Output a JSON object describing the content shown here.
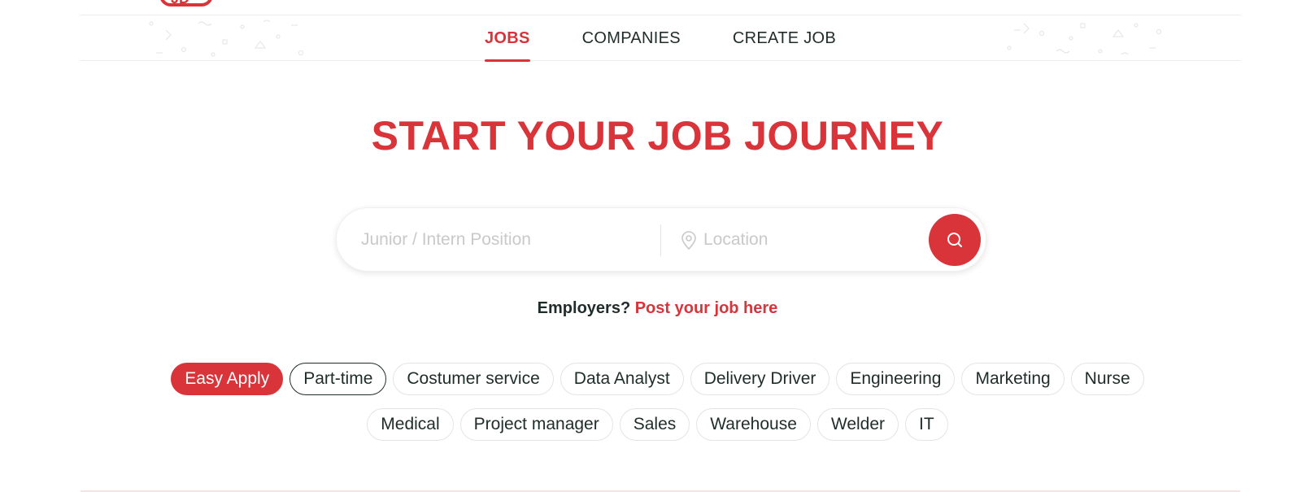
{
  "logo": {
    "text": "JD"
  },
  "nav": {
    "tabs": [
      {
        "label": "JOBS",
        "active": true
      },
      {
        "label": "COMPANIES",
        "active": false
      },
      {
        "label": "CREATE JOB",
        "active": false
      }
    ]
  },
  "hero": {
    "title": "START YOUR JOB JOURNEY"
  },
  "search": {
    "position_placeholder": "Junior / Intern Position",
    "location_placeholder": "Location",
    "position_value": "",
    "location_value": ""
  },
  "employers": {
    "question": "Employers?",
    "link": "Post your job here"
  },
  "tags": {
    "row1": [
      {
        "label": "Easy Apply",
        "style": "filled"
      },
      {
        "label": "Part-time",
        "style": "outlined"
      },
      {
        "label": "Costumer service",
        "style": "plain"
      },
      {
        "label": "Data Analyst",
        "style": "plain"
      },
      {
        "label": "Delivery Driver",
        "style": "plain"
      },
      {
        "label": "Engineering",
        "style": "plain"
      },
      {
        "label": "Marketing",
        "style": "plain"
      },
      {
        "label": "Nurse",
        "style": "plain"
      }
    ],
    "row2": [
      {
        "label": "Medical",
        "style": "plain"
      },
      {
        "label": "Project manager",
        "style": "plain"
      },
      {
        "label": "Sales",
        "style": "plain"
      },
      {
        "label": "Warehouse",
        "style": "plain"
      },
      {
        "label": "Welder",
        "style": "plain"
      },
      {
        "label": "IT",
        "style": "plain"
      }
    ]
  },
  "colors": {
    "accent": "#d93439",
    "text": "#1f2d2a",
    "placeholder": "#c9c9c9",
    "border": "#e4e4e4"
  },
  "icons": {
    "search": "search-icon",
    "location": "location-pin-icon"
  }
}
